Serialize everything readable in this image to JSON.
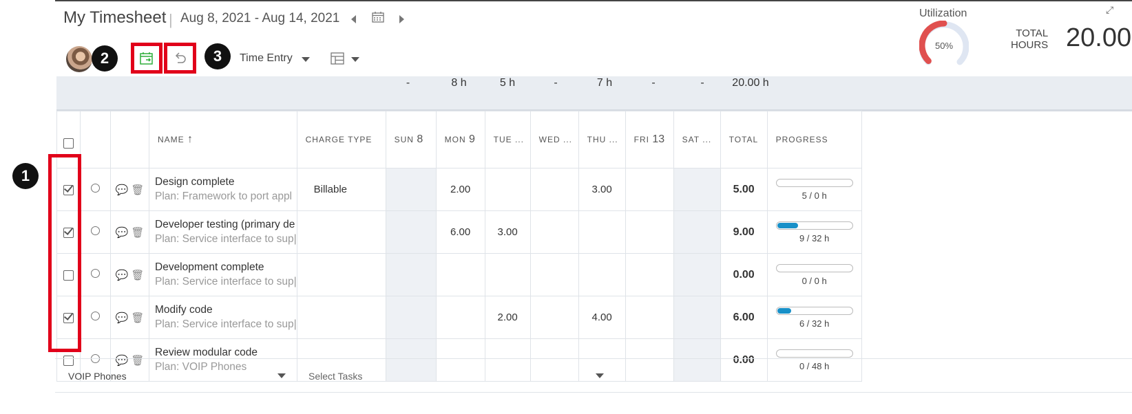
{
  "header": {
    "title": "My Timesheet",
    "separator": "|",
    "date_range": "Aug 8, 2021 - Aug 14, 2021",
    "view_selector": "Time Entry"
  },
  "annotations": {
    "badge1": "1",
    "badge2": "2",
    "badge3": "3"
  },
  "utilization": {
    "label": "Utilization",
    "percent_text": "50%",
    "percent": 50
  },
  "totals": {
    "label_line1": "TOTAL",
    "label_line2": "HOURS",
    "value": "20.00"
  },
  "summary": [
    "-",
    "8 h",
    "5 h",
    "-",
    "7 h",
    "-",
    "-",
    "20.00 h"
  ],
  "columns": {
    "name": "NAME",
    "charge_type": "CHARGE TYPE",
    "days": [
      {
        "abbr": "SUN",
        "num": "8"
      },
      {
        "abbr": "MON",
        "num": "9"
      },
      {
        "abbr": "TUE ...",
        "num": ""
      },
      {
        "abbr": "WED ...",
        "num": ""
      },
      {
        "abbr": "THU ...",
        "num": ""
      },
      {
        "abbr": "FRI",
        "num": "13"
      },
      {
        "abbr": "SAT ...",
        "num": ""
      }
    ],
    "total": "TOTAL",
    "progress": "PROGRESS"
  },
  "rows": [
    {
      "name": "Design complete",
      "plan": "Plan: Framework to port appl",
      "charge": "Billable",
      "days": [
        "",
        "2.00",
        "",
        "",
        "3.00",
        "",
        ""
      ],
      "total": "5.00",
      "progress_text": "5 / 0 h",
      "progress": 0,
      "checked": true
    },
    {
      "name": "Developer testing (primary de",
      "plan": "Plan: Service interface to sup|",
      "charge": "",
      "days": [
        "",
        "6.00",
        "3.00",
        "",
        "",
        "",
        ""
      ],
      "total": "9.00",
      "progress_text": "9 / 32 h",
      "progress": 0.28,
      "checked": true
    },
    {
      "name": "Development complete",
      "plan": "Plan: Service interface to sup|",
      "charge": "",
      "days": [
        "",
        "",
        "",
        "",
        "",
        "",
        ""
      ],
      "total": "0.00",
      "progress_text": "0 / 0 h",
      "progress": 0,
      "checked": false
    },
    {
      "name": "Modify code",
      "plan": "Plan: Service interface to sup|",
      "charge": "",
      "days": [
        "",
        "",
        "2.00",
        "",
        "4.00",
        "",
        ""
      ],
      "total": "6.00",
      "progress_text": "6 / 32 h",
      "progress": 0.19,
      "checked": true
    },
    {
      "name": "Review modular code",
      "plan": "Plan: VOIP Phones",
      "charge": "",
      "days": [
        "",
        "",
        "",
        "",
        "",
        "",
        ""
      ],
      "total": "0.00",
      "progress_text": "0 / 48 h",
      "progress": 0,
      "checked": false
    }
  ],
  "footer": {
    "project_select": "VOIP Phones",
    "task_select": "Select Tasks"
  },
  "colors": {
    "highlight": "#e1001a",
    "progress": "#1890c8",
    "gauge": "#e0504f",
    "copy_icon": "#2fae3a"
  }
}
